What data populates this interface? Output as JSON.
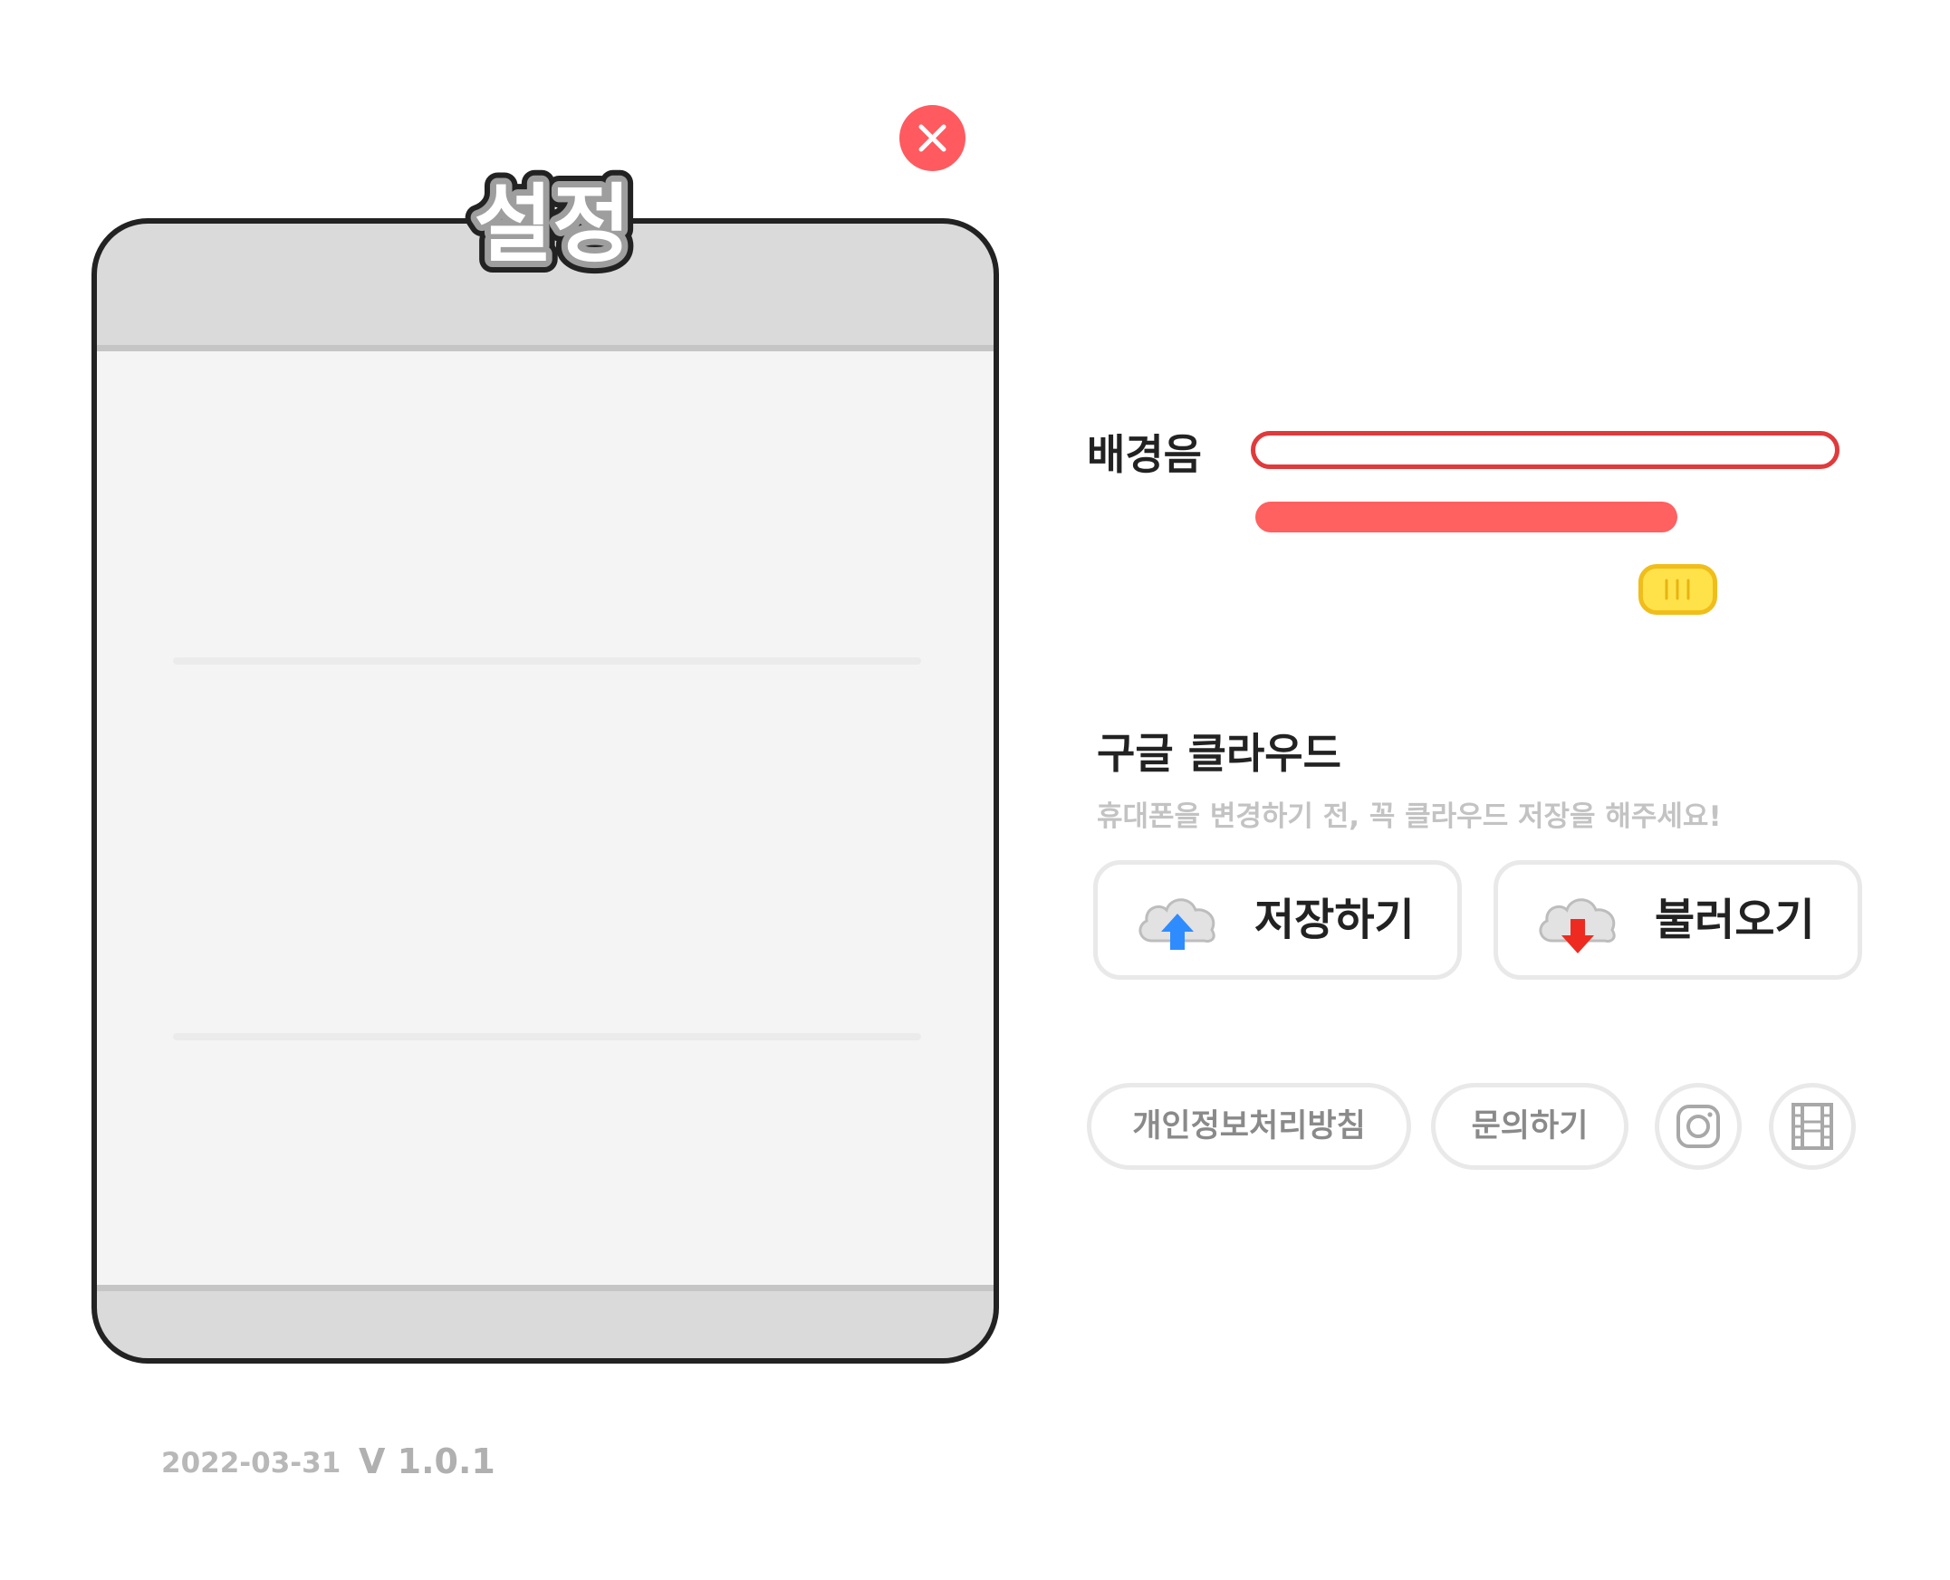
{
  "dialog": {
    "title": "설정",
    "close_icon": "close-icon"
  },
  "bgm": {
    "label": "배경음",
    "volume": 0.72,
    "knob_icon": "slider-grip-icon"
  },
  "cloud": {
    "title": "구글 클라우드",
    "subtitle": "휴대폰을 변경하기 전, 꼭 클라우드 저장을 해주세요!",
    "save_label": "저장하기",
    "save_icon": "cloud-upload-icon",
    "load_label": "불러오기",
    "load_icon": "cloud-download-icon"
  },
  "links": {
    "privacy_label": "개인정보처리방침",
    "contact_label": "문의하기",
    "instagram_icon": "instagram-icon",
    "video_icon": "film-icon"
  },
  "footer": {
    "date": "2022-03-31",
    "version": "V 1.0.1"
  },
  "colors": {
    "accent_red": "#ff5a5f",
    "track_red": "#e03a3c",
    "knob_yellow": "#ffe24a",
    "upload_blue": "#2e8cff",
    "download_red": "#ee2b20"
  }
}
